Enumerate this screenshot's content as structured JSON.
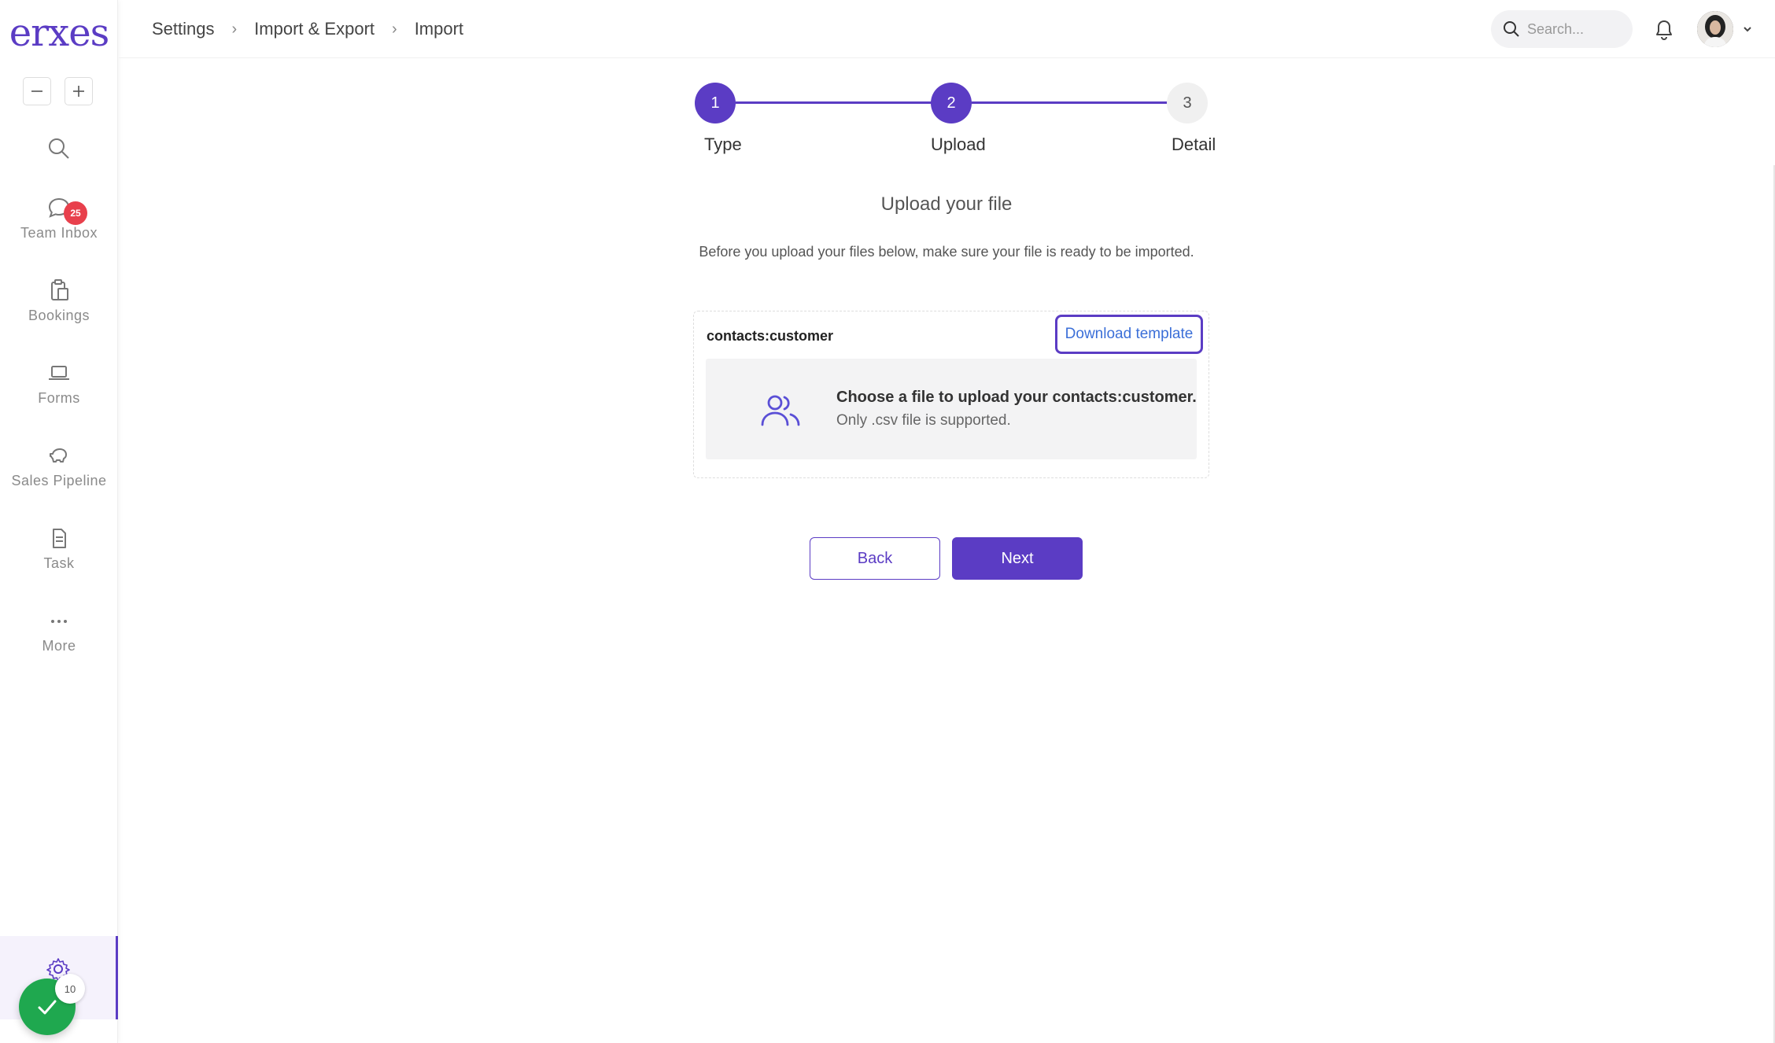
{
  "app": {
    "logo": "erxes"
  },
  "breadcrumb": {
    "items": [
      "Settings",
      "Import & Export",
      "Import"
    ],
    "separator": "›"
  },
  "header": {
    "search_placeholder": "Search..."
  },
  "sidebar": {
    "items": [
      {
        "label": "",
        "icon": "search-icon"
      },
      {
        "label": "Team Inbox",
        "icon": "chat-icon",
        "badge": "25"
      },
      {
        "label": "Bookings",
        "icon": "clipboard-icon"
      },
      {
        "label": "Forms",
        "icon": "laptop-icon"
      },
      {
        "label": "Sales Pipeline",
        "icon": "piggy-bank-icon"
      },
      {
        "label": "Task",
        "icon": "document-icon"
      },
      {
        "label": "More",
        "icon": "more-icon"
      }
    ],
    "settings_icon": "gear-icon",
    "onboarding_count": "10"
  },
  "stepper": {
    "steps": [
      {
        "number": "1",
        "label": "Type",
        "state": "complete"
      },
      {
        "number": "2",
        "label": "Upload",
        "state": "active"
      },
      {
        "number": "3",
        "label": "Detail",
        "state": "pending"
      }
    ]
  },
  "main": {
    "title": "Upload your file",
    "description": "Before you upload your files below, make sure your file is ready to be imported.",
    "card": {
      "type_name": "contacts:customer",
      "download_label": "Download template",
      "drop_title": "Choose a file to upload your contacts:customer.",
      "drop_subtitle": "Only .csv file is supported."
    },
    "buttons": {
      "back": "Back",
      "next": "Next"
    }
  },
  "colors": {
    "accent": "#5b3cc4",
    "badge": "#e8404c",
    "success": "#1fa84f",
    "link": "#3b6fd8"
  }
}
